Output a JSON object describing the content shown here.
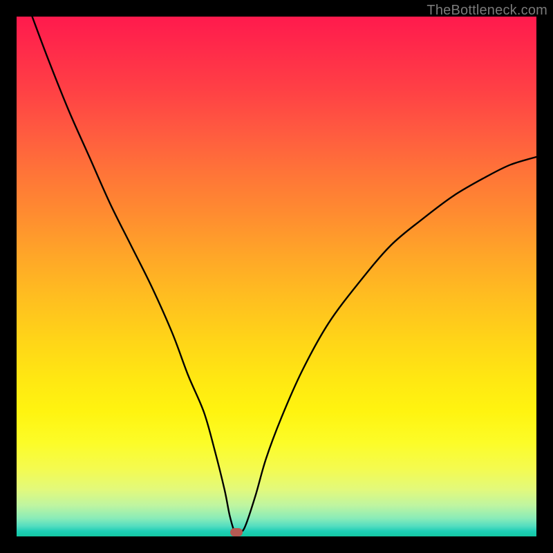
{
  "watermark": "TheBottleneck.com",
  "colors": {
    "frame": "#000000",
    "curve": "#000000",
    "marker": "#b65a53"
  },
  "chart_data": {
    "type": "line",
    "title": "",
    "xlabel": "",
    "ylabel": "",
    "xlim": [
      0,
      100
    ],
    "ylim": [
      0,
      100
    ],
    "grid": false,
    "note": "V-shaped bottleneck curve; minimum near x≈42 at y≈0. Left branch starts at top-left (x≈3, y=100) and descends with slight curvature to the trough. Right branch rises from the trough with decreasing slope toward top-right (x=100, y≈73). Values are percentages read from the plot extents; no axis ticks are shown.",
    "series": [
      {
        "name": "bottleneck-curve",
        "x": [
          3,
          6,
          10,
          14,
          18,
          22,
          26,
          30,
          33,
          36,
          38,
          40,
          41,
          42,
          43,
          44,
          46,
          48,
          51,
          55,
          60,
          66,
          72,
          78,
          84,
          90,
          95,
          100
        ],
        "y": [
          100,
          92,
          82,
          73,
          64,
          56,
          48,
          39,
          31,
          24,
          17,
          9,
          4,
          0.8,
          0.8,
          2,
          8,
          15,
          23,
          32,
          41,
          49,
          56,
          61,
          65.5,
          69,
          71.5,
          73
        ]
      }
    ],
    "annotations": [
      {
        "name": "trough-marker",
        "x": 42.3,
        "y": 0.8
      }
    ]
  }
}
